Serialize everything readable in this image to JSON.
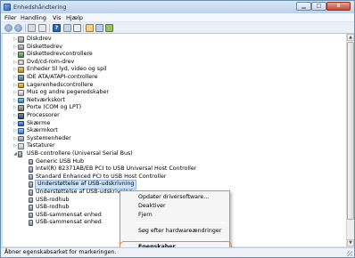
{
  "window": {
    "title": "Enhedshåndtering"
  },
  "menubar": {
    "items": [
      "Filer",
      "Handling",
      "Vis",
      "Hjælp"
    ]
  },
  "toolbar": {
    "help_glyph": "?"
  },
  "tree": [
    {
      "label": "Diskdrev",
      "level": 1,
      "expander": "▷",
      "icon": "drive-icon"
    },
    {
      "label": "Diskettedrev",
      "level": 1,
      "expander": "▷",
      "icon": "floppy-drive-icon"
    },
    {
      "label": "Diskettedrevcontrollere",
      "level": 1,
      "expander": "▷",
      "icon": "controller-icon"
    },
    {
      "label": "Dvd/cd-rom-drev",
      "level": 1,
      "expander": "▷",
      "icon": "disc-icon"
    },
    {
      "label": "Enheder til lyd, video og spil",
      "level": 1,
      "expander": "▷",
      "icon": "audio-icon"
    },
    {
      "label": "IDE ATA/ATAPI-controllere",
      "level": 1,
      "expander": "▷",
      "icon": "ide-icon"
    },
    {
      "label": "Lagerenhedscontrollere",
      "level": 1,
      "expander": "▷",
      "icon": "storage-icon"
    },
    {
      "label": "Mus og andre pegeredskaber",
      "level": 1,
      "expander": "▷",
      "icon": "mouse-icon"
    },
    {
      "label": "Netværkskort",
      "level": 1,
      "expander": "▷",
      "icon": "network-icon"
    },
    {
      "label": "Porte (COM og LPT)",
      "level": 1,
      "expander": "▷",
      "icon": "port-icon"
    },
    {
      "label": "Processorer",
      "level": 1,
      "expander": "▷",
      "icon": "processor-icon"
    },
    {
      "label": "Skærme",
      "level": 1,
      "expander": "▷",
      "icon": "display-icon"
    },
    {
      "label": "Skærmkort",
      "level": 1,
      "expander": "▷",
      "icon": "display-adapter-icon"
    },
    {
      "label": "Systemenheder",
      "level": 1,
      "expander": "▷",
      "icon": "system-icon"
    },
    {
      "label": "Tastaturer",
      "level": 1,
      "expander": "▷",
      "icon": "keyboard-icon"
    },
    {
      "label": "USB-controllere (Universal Serial Bus)",
      "level": 1,
      "expander": "◢",
      "icon": "usb-icon"
    },
    {
      "label": "Generic USB Hub",
      "level": 2,
      "expander": "",
      "icon": "usb-device-icon"
    },
    {
      "label": "Intel(R) 82371AB/EB PCI to USB Universal Host Controller",
      "level": 2,
      "expander": "",
      "icon": "usb-device-icon"
    },
    {
      "label": "Standard Enhanced PCI to USB Host Controller",
      "level": 2,
      "expander": "",
      "icon": "usb-device-icon"
    },
    {
      "label": "Understøttelse af USB-udskrivning",
      "level": 2,
      "expander": "",
      "icon": "usb-device-icon",
      "selected": true
    },
    {
      "label": "Understøttelse af USB-udskrivning",
      "level": 2,
      "expander": "",
      "icon": "usb-device-icon"
    },
    {
      "label": "USB-rodhub",
      "level": 2,
      "expander": "",
      "icon": "usb-device-icon"
    },
    {
      "label": "USB-rodhub",
      "level": 2,
      "expander": "",
      "icon": "usb-device-icon"
    },
    {
      "label": "USB-sammensat enhed",
      "level": 2,
      "expander": "",
      "icon": "usb-device-icon"
    },
    {
      "label": "USB-sammensat enhed",
      "level": 2,
      "expander": "",
      "icon": "usb-device-icon"
    }
  ],
  "context_menu": {
    "items": [
      {
        "label": "Opdater driversoftware...",
        "bold": false
      },
      {
        "label": "Deaktiver",
        "bold": false
      },
      {
        "label": "Fjern",
        "bold": false
      },
      {
        "separator": true
      },
      {
        "label": "Søg efter hardwareændringer",
        "bold": false
      },
      {
        "separator": true
      },
      {
        "label": "Egenskaber",
        "bold": true,
        "highlighted": true
      }
    ],
    "highlight_color": "#f08c21"
  },
  "statusbar": {
    "text": "Åbner egenskabsarket for markeringen."
  },
  "colors": {
    "selection": "#cde4fa",
    "titlebar": "#bcd2ea"
  }
}
